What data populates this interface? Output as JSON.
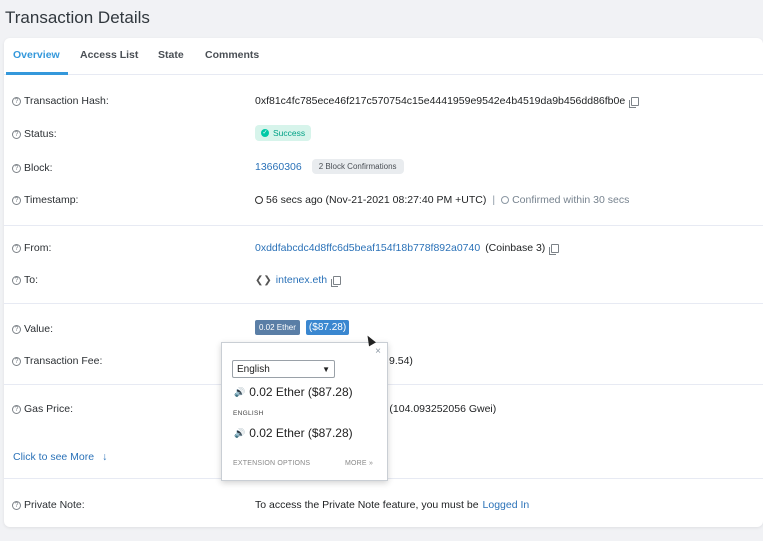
{
  "page": {
    "title": "Transaction Details"
  },
  "tabs": [
    {
      "label": "Overview",
      "active": true
    },
    {
      "label": "Access List",
      "active": false
    },
    {
      "label": "State",
      "active": false
    },
    {
      "label": "Comments",
      "active": false
    }
  ],
  "rows": {
    "hash": {
      "label": "Transaction Hash:",
      "value": "0xf81c4fc785ece46f217c570754c15e4441959e9542e4b4519da9b456dd86fb0e"
    },
    "status": {
      "label": "Status:",
      "value": "Success"
    },
    "block": {
      "label": "Block:",
      "value": "13660306",
      "confirmations": "2 Block Confirmations"
    },
    "timestamp": {
      "label": "Timestamp:",
      "value": "56 secs ago (Nov-21-2021 08:27:40 PM +UTC)",
      "separator": "|",
      "confirmed": "Confirmed within 30 secs"
    },
    "from": {
      "label": "From:",
      "address": "0xddfabcdc4d8ffc6d5beaf154f18b778f892a0740",
      "name": "(Coinbase 3)"
    },
    "to": {
      "label": "To:",
      "address": "intenex.eth"
    },
    "value": {
      "label": "Value:",
      "ether": "0.02 Ether",
      "usd": "($87.28)"
    },
    "fee": {
      "label": "Transaction Fee:",
      "partial": "9.54)"
    },
    "gas": {
      "label": "Gas Price:",
      "partial": "r (104.093252056 Gwei)"
    },
    "more": {
      "label": "Click to see More",
      "arrow": "↓"
    },
    "note": {
      "label": "Private Note:",
      "text": "To access the Private Note feature, you must be",
      "link": "Logged In"
    }
  },
  "popup": {
    "close": "×",
    "language": "English",
    "translation1": "0.02 Ether ($87.28)",
    "lang_label": "ENGLISH",
    "translation2": "0.02 Ether ($87.28)",
    "extension_options": "EXTENSION OPTIONS",
    "more": "MORE »"
  },
  "icons": {
    "question": "?",
    "speaker": "🔊",
    "contract": "❮❯",
    "success_check": "✓",
    "caret": "▼"
  },
  "colors": {
    "accent": "#3498db",
    "link": "#2b72b8",
    "success_bg": "#d7f4eb",
    "success_text": "#00a186"
  }
}
